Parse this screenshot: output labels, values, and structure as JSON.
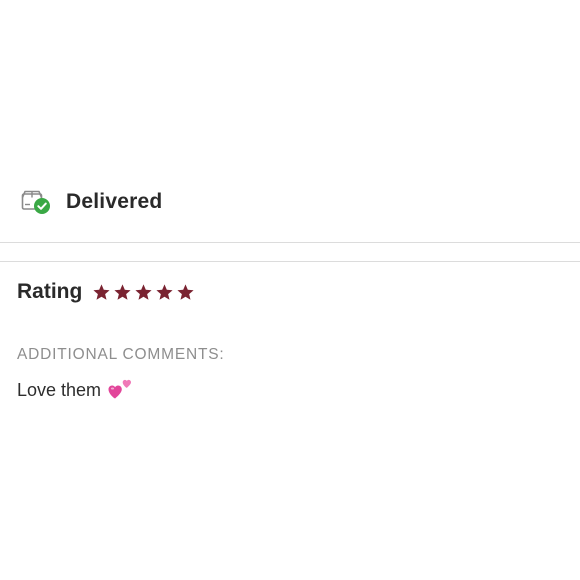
{
  "status": {
    "label": "Delivered",
    "icon": "delivered-box-check-icon",
    "check_color": "#3aa845"
  },
  "rating": {
    "label": "Rating",
    "stars": 5,
    "max_stars": 5,
    "star_color": "#7a2331"
  },
  "comments": {
    "heading": "ADDITIONAL COMMENTS:",
    "text": "Love them",
    "emoji": "two-hearts-emoji"
  }
}
